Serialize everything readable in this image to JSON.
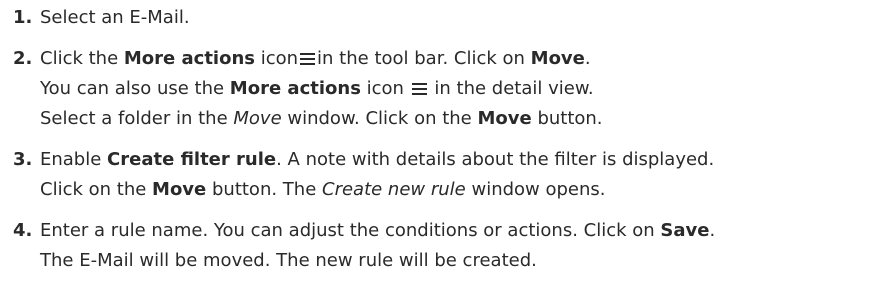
{
  "steps": [
    {
      "number": "1.",
      "lines": [
        {
          "t1": "Select an E-Mail."
        }
      ]
    },
    {
      "number": "2.",
      "lines": [
        {
          "t1": "Click the ",
          "b1": "More actions",
          "t2": " icon",
          "t3": "in the tool bar. Click on ",
          "b2": "Move",
          "t4": "."
        },
        {
          "t1": "You can also use the ",
          "b1": "More actions",
          "t2": " icon ",
          "t3": " in the detail view."
        },
        {
          "t1": "Select a folder in the ",
          "i1": "Move",
          "t2": " window. Click on the ",
          "b1": "Move",
          "t3": " button."
        }
      ]
    },
    {
      "number": "3.",
      "lines": [
        {
          "t1": "Enable ",
          "b1": "Create filter rule",
          "t2": ". A note with details about the filter is displayed."
        },
        {
          "t1": "Click on the ",
          "b1": "Move",
          "t2": " button. The ",
          "i1": "Create new rule",
          "t3": " window opens."
        }
      ]
    },
    {
      "number": "4.",
      "lines": [
        {
          "t1": "Enter a rule name. You can adjust the conditions or actions. Click on ",
          "b1": "Save",
          "t2": "."
        },
        {
          "t1": "The E-Mail will be moved. The new rule will be created."
        }
      ]
    }
  ],
  "icons": {
    "more_actions": "hamburger-menu-icon"
  }
}
